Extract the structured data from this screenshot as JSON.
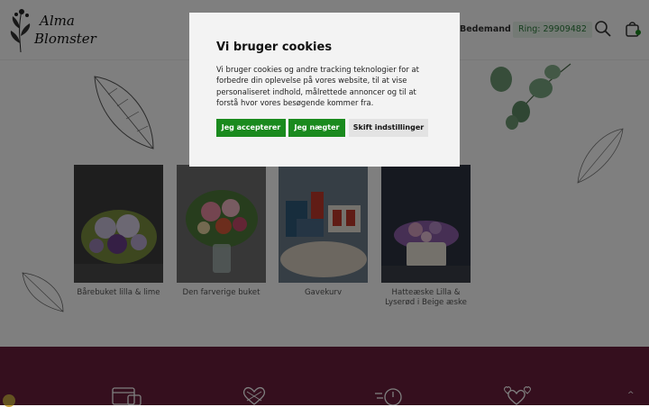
{
  "header": {
    "logo_line1": "Alma",
    "logo_line2": "Blomster",
    "nav_item": "Bedemand",
    "phone_label": "Ring: 29909482"
  },
  "products": [
    {
      "name": "Bårebuket lilla & lime",
      "colors": {
        "bg": "#3c3c3c",
        "main": "#c9c0da",
        "accent": "#6a3f8a",
        "leaf": "#7a8f3e"
      }
    },
    {
      "name": "Den farverige buket",
      "colors": {
        "bg": "#6e6e6e",
        "main": "#e88aa0",
        "accent": "#d85a3a",
        "leaf": "#4f7a3a"
      }
    },
    {
      "name": "Gavekurv",
      "colors": {
        "bg": "#6c7c8a",
        "main": "#d8cfc0",
        "accent": "#c0392b",
        "leaf": "#2f5a7a"
      }
    },
    {
      "name": "Hatteæske Lilla & Lyserød i Beige æske",
      "colors": {
        "bg": "#2c3240",
        "main": "#8d5fa8",
        "accent": "#d7a0c0",
        "leaf": "#e8e2d6"
      }
    }
  ],
  "cookie_modal": {
    "title": "Vi bruger cookies",
    "body": "Vi bruger cookies og andre tracking teknologier for at forbedre din oplevelse på vores website, til at vise personaliseret indhold, målrettede annoncer og til at forstå hvor vores besøgende kommer fra.",
    "accept_label": "Jeg accepterer",
    "deny_label": "Jeg nægter",
    "settings_label": "Skift indstillinger"
  },
  "footer": {
    "icons": [
      "card-icon",
      "heart-knot-icon",
      "fast-delivery-icon",
      "hearts-icon"
    ],
    "scroll_top": "^"
  },
  "colors": {
    "accent_green": "#1a8a1e",
    "footer_band": "#6a1f3c",
    "phone_bg": "#e9f5ea"
  }
}
